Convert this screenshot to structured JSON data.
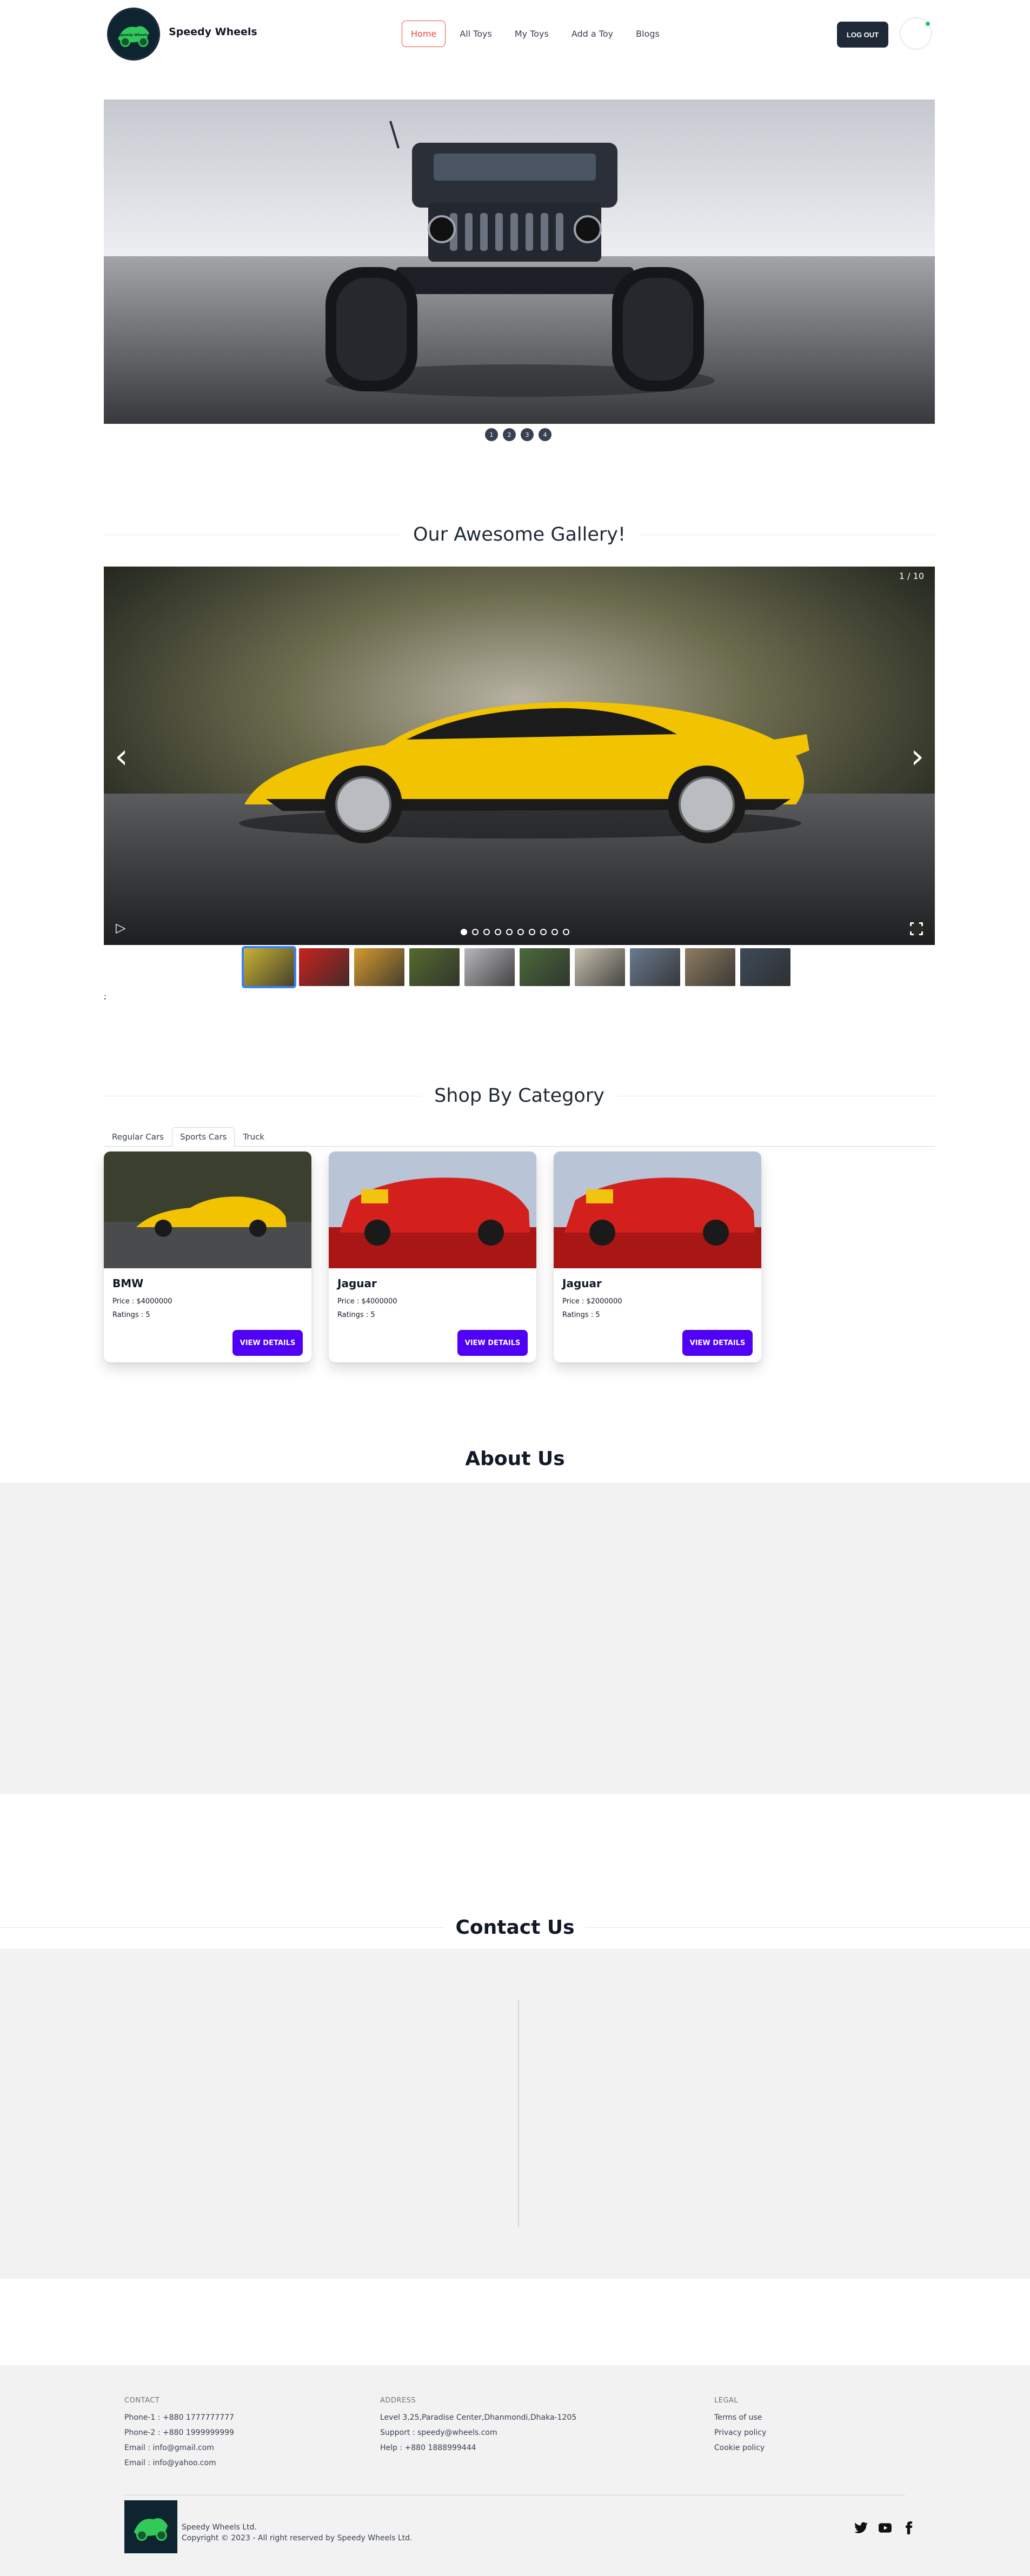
{
  "brand": {
    "name": "Speedy Wheels",
    "logo_text": "Speedy Wheels"
  },
  "nav": {
    "links": [
      {
        "label": "Home",
        "active": true
      },
      {
        "label": "All Toys",
        "active": false
      },
      {
        "label": "My Toys",
        "active": false
      },
      {
        "label": "Add a Toy",
        "active": false
      },
      {
        "label": "Blogs",
        "active": false
      }
    ],
    "logout_label": "LOG OUT"
  },
  "hero": {
    "slide_labels": [
      "1",
      "2",
      "3",
      "4"
    ]
  },
  "gallery": {
    "title": "Our Awesome Gallery!",
    "counter": "1 / 10",
    "prev_icon": "‹",
    "next_icon": "›",
    "play_icon": "▷",
    "note": ";",
    "thumb_colors": [
      "#c9b233",
      "#c8231f",
      "#d49a2f",
      "#556b2f",
      "#b8b8bc",
      "#4a6b3a",
      "#c7c1b0",
      "#6b7a8f",
      "#8f7d62",
      "#3e4a5a"
    ]
  },
  "shop": {
    "title": "Shop By Category",
    "tabs": [
      {
        "label": "Regular Cars",
        "active": false
      },
      {
        "label": "Sports Cars",
        "active": true
      },
      {
        "label": "Truck",
        "active": false
      }
    ],
    "cards": [
      {
        "name": "BMW",
        "price": "Price : $4000000",
        "rating": "Ratings : 5",
        "button": "VIEW DETAILS",
        "color": "#f2c300"
      },
      {
        "name": "Jaguar",
        "price": "Price : $4000000",
        "rating": "Ratings : 5",
        "button": "VIEW DETAILS",
        "color": "#d3201c"
      },
      {
        "name": "Jaguar",
        "price": "Price : $2000000",
        "rating": "Ratings : 5",
        "button": "VIEW DETAILS",
        "color": "#d3201c"
      }
    ]
  },
  "about": {
    "title": "About Us"
  },
  "contact": {
    "title": "Contact Us"
  },
  "footer": {
    "contact": {
      "heading": "CONTACT",
      "items": [
        "Phone-1 : +880 1777777777",
        "Phone-2 : +880 1999999999",
        "Email : info@gmail.com",
        "Email : info@yahoo.com"
      ]
    },
    "address": {
      "heading": "ADDRESS",
      "items": [
        "Level 3,25,Paradise Center,Dhanmondi,Dhaka-1205",
        "Support : speedy@wheels.com",
        "Help : +880 1888999444"
      ]
    },
    "legal": {
      "heading": "LEGAL",
      "items": [
        "Terms of use",
        "Privacy policy",
        "Cookie policy"
      ]
    },
    "company": "Speedy Wheels Ltd.",
    "copyright": "Copyright © 2023 - All right reserved by Speedy Wheels Ltd.",
    "social": [
      "twitter-icon",
      "youtube-icon",
      "facebook-icon"
    ]
  },
  "colors": {
    "accent": "#4f00f5",
    "active_nav": "#ef4444",
    "dark": "#1f2937",
    "panel": "#f2f2f2"
  }
}
